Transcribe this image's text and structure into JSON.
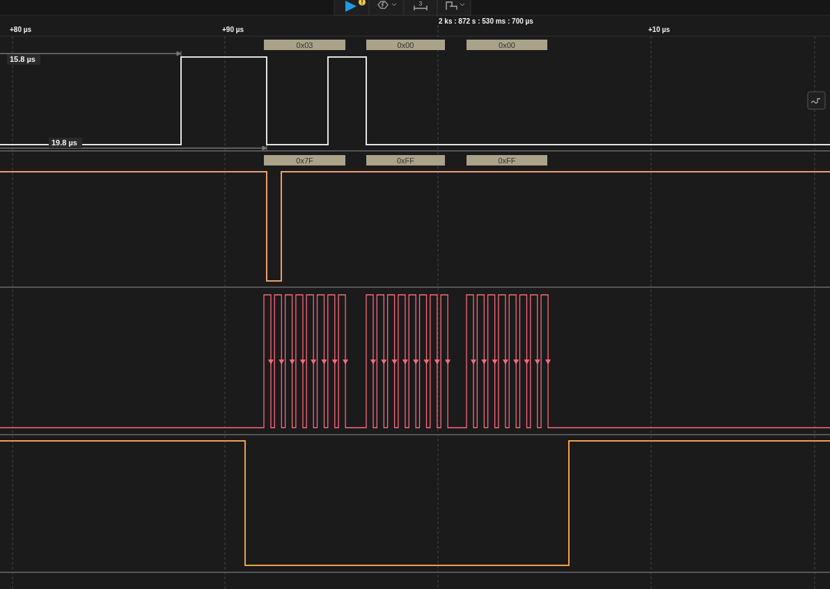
{
  "toolbar": [
    {
      "kind": "play",
      "alert": true
    },
    {
      "kind": "trigger"
    },
    {
      "kind": "measure",
      "label": "3"
    },
    {
      "kind": "layout"
    }
  ],
  "timestamp": "2 ks : 872 s : 530 ms : 700 µs",
  "ruler_ticks": [
    "+80 µs",
    "+90 µs",
    "+10 µs"
  ],
  "measurements": [
    "15.8 µs",
    "19.8 µs"
  ],
  "channels": [
    {
      "color": "#e6e6e6",
      "decoded": [
        "0x03",
        "0x00",
        "0x00"
      ]
    },
    {
      "color": "#f0a070",
      "decoded": [
        "0x7F",
        "0xFF",
        "0xFF"
      ]
    },
    {
      "color": "#ff6b7a"
    },
    {
      "color": "#f5a04a"
    }
  ]
}
